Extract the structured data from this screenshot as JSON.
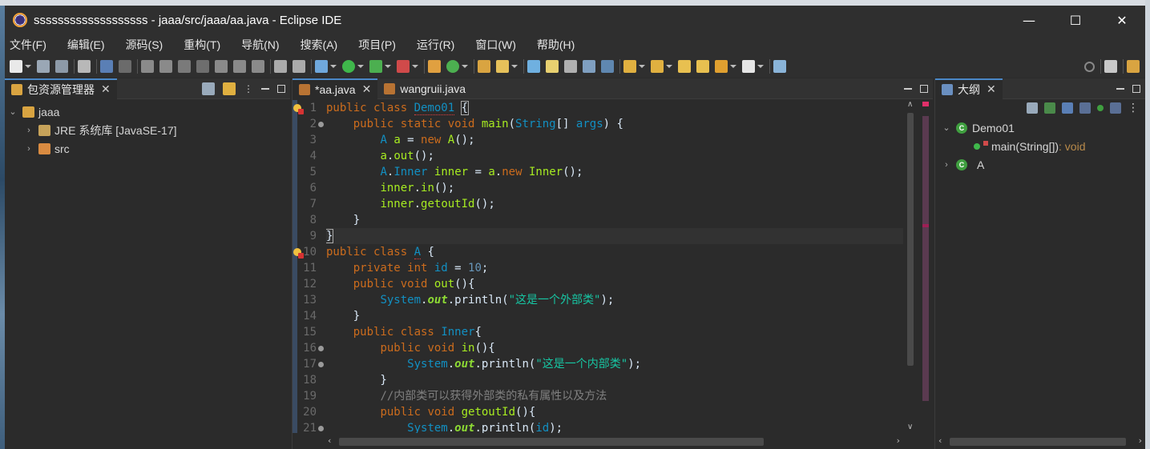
{
  "window": {
    "title": "sssssssssssssssssss - jaaa/src/jaaa/aa.java - Eclipse IDE",
    "minimize": "—",
    "maximize": "☐",
    "close": "✕"
  },
  "menu": [
    "文件(F)",
    "编辑(E)",
    "源码(S)",
    "重构(T)",
    "导航(N)",
    "搜索(A)",
    "项目(P)",
    "运行(R)",
    "窗口(W)",
    "帮助(H)"
  ],
  "explorer": {
    "tab_label": "包资源管理器",
    "tree": [
      {
        "label": "jaaa",
        "expanded": true,
        "level": 0
      },
      {
        "label": "JRE 系统库 [JavaSE-17]",
        "expanded": false,
        "level": 1
      },
      {
        "label": "src",
        "expanded": false,
        "level": 1
      }
    ]
  },
  "editor": {
    "tabs": [
      {
        "label": "*aa.java",
        "active": true
      },
      {
        "label": "wangruii.java",
        "active": false
      }
    ],
    "line_numbers": [
      "1",
      "2",
      "3",
      "4",
      "5",
      "6",
      "7",
      "8",
      "9",
      "10",
      "11",
      "12",
      "13",
      "14",
      "15",
      "16",
      "17",
      "18",
      "19",
      "20",
      "21"
    ],
    "strings": {
      "s1": "\"这是一个外部类\"",
      "s2": "\"这是一个内部类\"",
      "comment": "//内部类可以获得外部类的私有属性以及方法"
    }
  },
  "outline": {
    "tab_label": "大纲",
    "items": [
      {
        "label": "Demo01",
        "expanded": true
      },
      {
        "label": "main(String[])",
        "type": " : void"
      },
      {
        "label": "A",
        "expanded": false
      }
    ]
  },
  "colors": {
    "keyword": "#cc6c1d",
    "type": "#1290c3",
    "method": "#a7ec21",
    "string": "#17c6a3",
    "accent": "#4a88c7"
  }
}
